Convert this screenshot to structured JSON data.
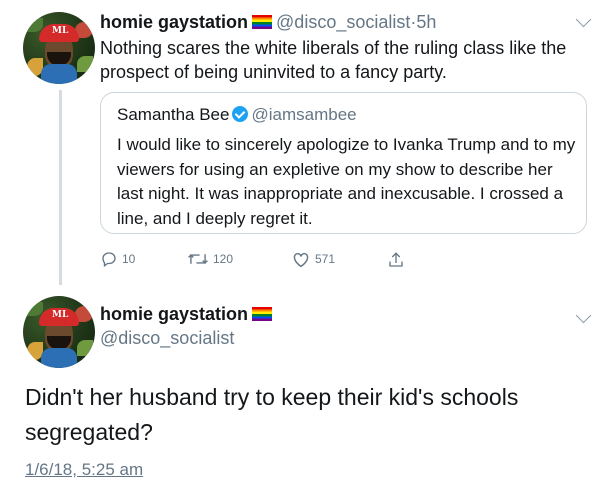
{
  "tweet1": {
    "display_name": "homie gaystation",
    "handle": "@disco_socialist",
    "separator": "·",
    "time": "5h",
    "text": "Nothing scares the white liberals of the ruling class like the prospect of being uninvited to a fancy party.",
    "quoted": {
      "display_name": "Samantha Bee",
      "handle": "@iamsambee",
      "text": "I would like to sincerely apologize to Ivanka Trump and to my viewers for using an expletive on my show to describe her last night. It was inappropriate and inexcusable. I crossed a line, and I deeply regret it."
    },
    "actions": {
      "reply_count": "10",
      "retweet_count": "120",
      "like_count": "571"
    }
  },
  "tweet2": {
    "display_name": "homie gaystation",
    "handle": "@disco_socialist",
    "text": "Didn't her husband try to keep their kid's schools segregated?",
    "timestamp": "1/6/18, 5:25 am"
  },
  "avatar_cap_letters": "ML",
  "colors": {
    "text": "#14171a",
    "muted": "#657786",
    "verified": "#1da1f2",
    "border": "#ccd6dd",
    "cap_red": "#d42a2a"
  },
  "icons": [
    "reply-icon",
    "retweet-icon",
    "like-icon",
    "share-icon",
    "chevron-down-icon",
    "rainbow-flag-icon",
    "verified-icon"
  ]
}
